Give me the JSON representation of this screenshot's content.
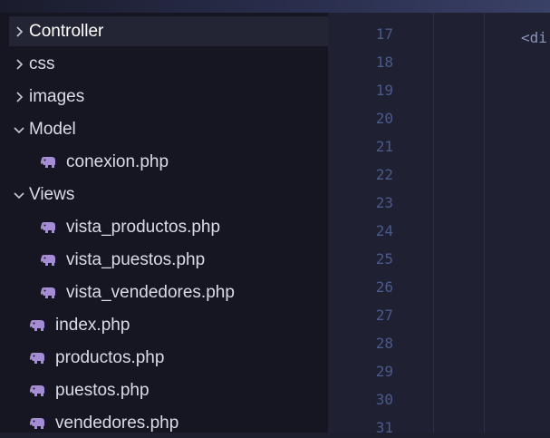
{
  "explorer": {
    "items": [
      {
        "label": "Controller",
        "kind": "folder",
        "state": "collapsed",
        "indent": 0,
        "selected": true
      },
      {
        "label": "css",
        "kind": "folder",
        "state": "collapsed",
        "indent": 0,
        "selected": false
      },
      {
        "label": "images",
        "kind": "folder",
        "state": "collapsed",
        "indent": 0,
        "selected": false
      },
      {
        "label": "Model",
        "kind": "folder",
        "state": "expanded",
        "indent": 0,
        "selected": false
      },
      {
        "label": "conexion.php",
        "kind": "php-file",
        "indent": 1,
        "selected": false
      },
      {
        "label": "Views",
        "kind": "folder",
        "state": "expanded",
        "indent": 0,
        "selected": false
      },
      {
        "label": "vista_productos.php",
        "kind": "php-file",
        "indent": 1,
        "selected": false
      },
      {
        "label": "vista_puestos.php",
        "kind": "php-file",
        "indent": 1,
        "selected": false
      },
      {
        "label": "vista_vendedores.php",
        "kind": "php-file",
        "indent": 1,
        "selected": false
      },
      {
        "label": "index.php",
        "kind": "php-file",
        "indent": 0,
        "selected": false
      },
      {
        "label": "productos.php",
        "kind": "php-file",
        "indent": 0,
        "selected": false
      },
      {
        "label": "puestos.php",
        "kind": "php-file",
        "indent": 0,
        "selected": false
      },
      {
        "label": "vendedores.php",
        "kind": "php-file",
        "indent": 0,
        "selected": false
      }
    ]
  },
  "editor": {
    "line_numbers": [
      "17",
      "18",
      "19",
      "20",
      "21",
      "22",
      "23",
      "24",
      "25",
      "26",
      "27",
      "28",
      "29",
      "30",
      "31"
    ],
    "code_snippet": "<di"
  },
  "colors": {
    "php_icon": "#a58dd6",
    "sidebar_bg": "#151621",
    "editor_bg": "#1f2133",
    "line_number": "#4a5a8a"
  },
  "icons": {
    "chevron_collapsed": "chevron-right-icon",
    "chevron_expanded": "chevron-down-icon",
    "php_file": "php-elephant-icon"
  }
}
